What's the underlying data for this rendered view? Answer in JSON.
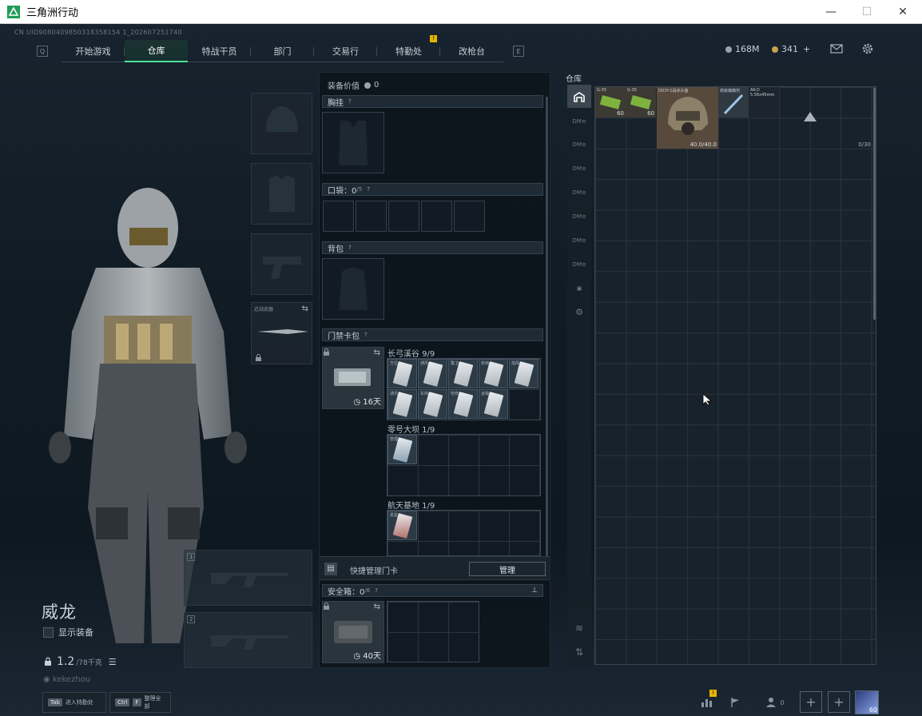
{
  "window": {
    "title": "三角洲行动",
    "minimize": "—",
    "maximize": "☐",
    "close": "✕"
  },
  "uid": "CN UID9080409850318358154 1_202607251740",
  "nav": {
    "left_key": "Q",
    "right_key": "E",
    "tabs": [
      {
        "label": "开始游戏",
        "active": false
      },
      {
        "label": "仓库",
        "active": true
      },
      {
        "label": "特战干员",
        "active": false
      },
      {
        "label": "部门",
        "active": false
      },
      {
        "label": "交易行",
        "active": false
      },
      {
        "label": "特勤处",
        "active": false,
        "badge": "!"
      },
      {
        "label": "改枪台",
        "active": false
      }
    ]
  },
  "currency": {
    "hafcoin": "168M",
    "coupon": "341",
    "add": "+"
  },
  "character": {
    "name": "威龙",
    "show_equipment": "显示装备",
    "weight_value": "1.2",
    "weight_unit": "/78千克",
    "player_id": "kekezhou"
  },
  "slots": {
    "melee_label": "近战武器",
    "weapon1": "1",
    "weapon2": "2"
  },
  "equipment": {
    "value_label": "装备价值",
    "value": "0",
    "chest_rig": "胸挂",
    "pockets": "口袋：0",
    "pockets_max": "/5",
    "backpack": "背包",
    "keycard_wallet": "门禁卡包",
    "wallet_days": "16天",
    "map1": "长弓溪谷 9/9",
    "map2": "零号大坝 1/9",
    "map3": "航天基地 1/9",
    "map1_cards": [
      "方位",
      "通风",
      "警卫",
      "收纳",
      "指挥",
      "通讯",
      "车库",
      "检修",
      "运输"
    ],
    "map2_cards": [
      "管理"
    ],
    "map3_cards": [
      "黑室"
    ],
    "quick_manage": "快捷管理门卡",
    "manage_button": "管理",
    "safebox": "安全箱：0",
    "safebox_max": "/6",
    "safebox_days": "40天",
    "pin": "⊥"
  },
  "storage": {
    "title": "仓库",
    "capacity": "0/30",
    "items": [
      {
        "caption": "G-35",
        "count": "60",
        "color": "#3c3a33"
      },
      {
        "caption": "G-35",
        "count": "60",
        "color": "#3c3a33"
      },
      {
        "caption": "DICH-1战术头盔",
        "count": "40.0/40.0",
        "color": "#574a3c"
      },
      {
        "caption": "高级镇痛剂",
        "count": "",
        "color": "#2f3942"
      },
      {
        "caption": "AK-D 5.56x45mm",
        "count": "",
        "color": "#1c252d"
      }
    ]
  },
  "bottom": {
    "hint1_key": "Tab",
    "hint1_text": "进入特勤处",
    "hint2_key1": "Ctrl",
    "hint2_key2": "F",
    "hint2_text": "整理全部",
    "badge": "!",
    "count": "0",
    "avatar_level": "60"
  }
}
